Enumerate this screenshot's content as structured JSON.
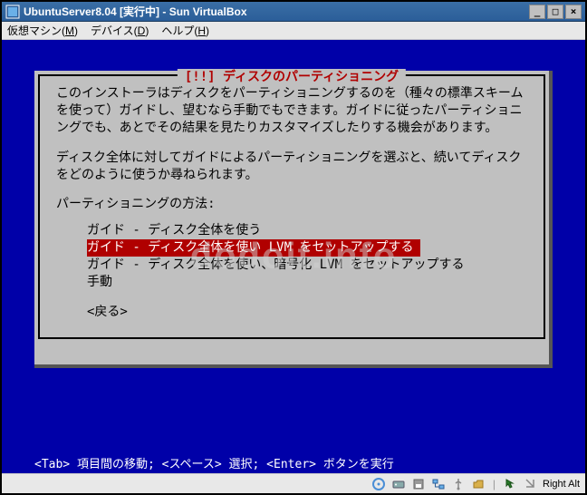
{
  "titlebar": {
    "title": "UbuntuServer8.04 [実行中] - Sun VirtualBox"
  },
  "menubar": {
    "machine": "仮想マシン",
    "machine_key": "M",
    "device": "デバイス",
    "device_key": "D",
    "help": "ヘルプ",
    "help_key": "H"
  },
  "dialog": {
    "title": "[!!] ディスクのパーティショニング",
    "para1": "このインストーラはディスクをパーティショニングするのを（種々の標準スキームを使って）ガイドし、望むなら手動でもできます。ガイドに従ったパーティショニングでも、あとでその結果を見たりカスタマイズしたりする機会があります。",
    "para2": "ディスク全体に対してガイドによるパーティショニングを選ぶと、続いてディスクをどのように使うか尋ねられます。",
    "prompt": "パーティショニングの方法:",
    "options": {
      "o0": "ガイド - ディスク全体を使う",
      "o1": "ガイド - ディスク全体を使い LVM をセットアップする",
      "o2": "ガイド - ディスク全体を使い、暗号化 LVM をセットアップする",
      "o3": "手動"
    },
    "back": "<戻る>"
  },
  "hint": "<Tab> 項目間の移動; <スペース> 選択; <Enter> ボタンを実行",
  "statusbar": {
    "hostkey": "Right Alt"
  },
  "watermark": "dodoit.info"
}
